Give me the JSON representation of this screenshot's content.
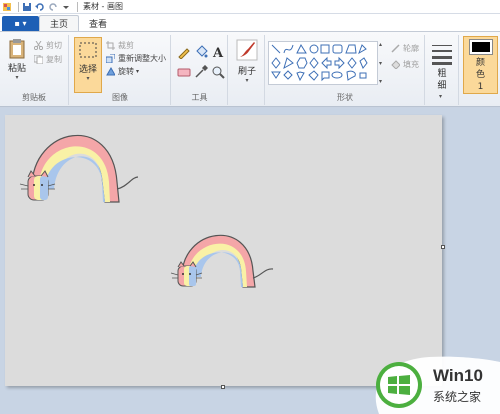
{
  "titlebar": {
    "title": "素材 - 画图"
  },
  "tabs": {
    "file": "▪ ▾",
    "home": "主页",
    "view": "查看"
  },
  "ribbon": {
    "clipboard": {
      "paste": "粘贴",
      "cut": "剪切",
      "copy": "复制",
      "label": "剪贴板"
    },
    "image": {
      "select": "选择",
      "crop": "裁剪",
      "resize": "重新调整大小",
      "rotate": "旋转",
      "label": "图像"
    },
    "tools": {
      "label": "工具"
    },
    "brushes": {
      "label": "刷子"
    },
    "shapes": {
      "outline": "轮廓",
      "fill": "填充",
      "label": "形状"
    },
    "size": {
      "label": "粗细"
    },
    "color1": {
      "label": "颜色 1"
    }
  },
  "watermark": {
    "brand": "Win10",
    "subtitle": "系统之家"
  },
  "colors": {
    "accent": "#1e5fb5",
    "pen_active": "#fbd99a",
    "rainbow_red": "#f4a6a8",
    "rainbow_yellow": "#f9f1a6",
    "rainbow_blue": "#a9c6ec"
  }
}
